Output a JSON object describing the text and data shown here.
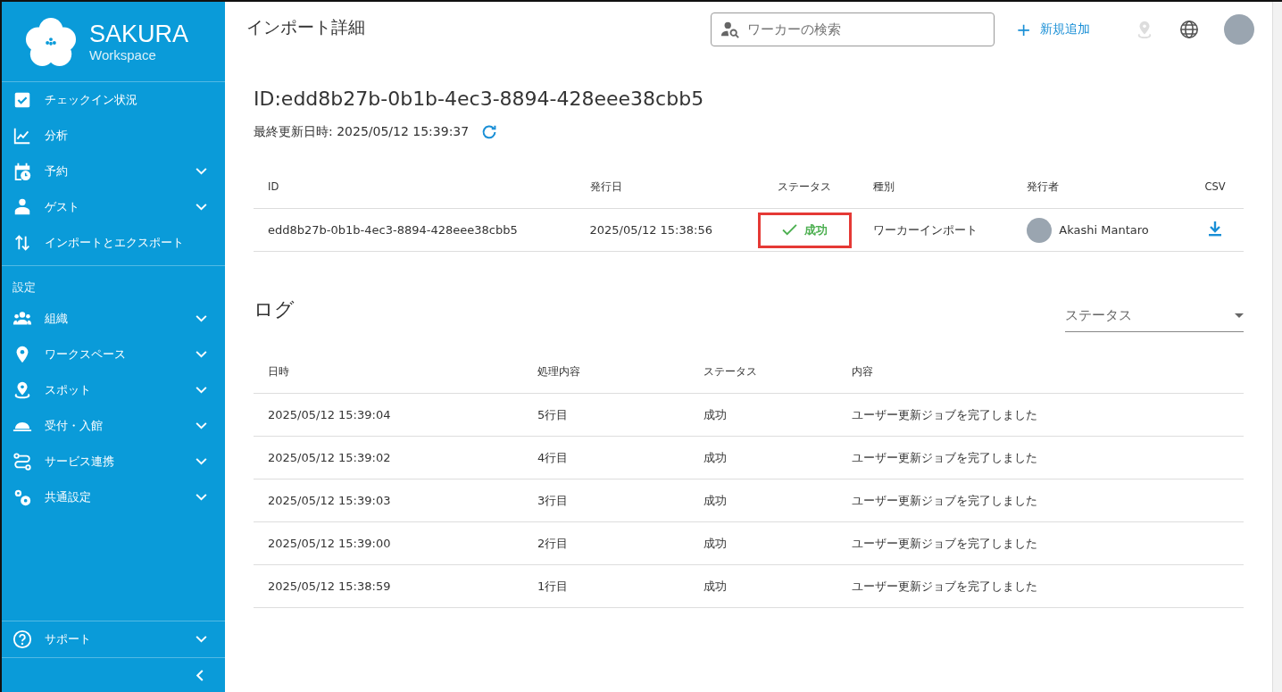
{
  "brand": {
    "name": "SAKURA",
    "sub": "Workspace"
  },
  "sidebar": {
    "items": [
      {
        "label": "チェックイン状況",
        "expandable": false
      },
      {
        "label": "分析",
        "expandable": false
      },
      {
        "label": "予約",
        "expandable": true
      },
      {
        "label": "ゲスト",
        "expandable": true
      },
      {
        "label": "インポートとエクスポート",
        "expandable": false
      }
    ],
    "section": "設定",
    "settings": [
      {
        "label": "組織",
        "expandable": true
      },
      {
        "label": "ワークスペース",
        "expandable": true
      },
      {
        "label": "スポット",
        "expandable": true
      },
      {
        "label": "受付・入館",
        "expandable": true
      },
      {
        "label": "サービス連携",
        "expandable": true
      },
      {
        "label": "共通設定",
        "expandable": true
      }
    ],
    "footer": [
      {
        "label": "サポート",
        "expandable": true
      }
    ]
  },
  "header": {
    "title": "インポート詳細",
    "search": {
      "placeholder": "ワーカーの検索"
    },
    "add_button": "新規追加",
    "add_icon": "+"
  },
  "detail": {
    "heading": "ID:edd8b27b-0b1b-4ec3-8894-428eee38cbb5",
    "updated": "最終更新日時: 2025/05/12 15:39:37",
    "columns": [
      "ID",
      "発行日",
      "ステータス",
      "種別",
      "発行者",
      "CSV"
    ],
    "row": {
      "id": "edd8b27b-0b1b-4ec3-8894-428eee38cbb5",
      "date": "2025/05/12 15:38:56",
      "status": "成功",
      "status_highlighted": true,
      "type": "ワーカーインポート",
      "issuer": "Akashi Mantaro"
    }
  },
  "log": {
    "heading": "ログ",
    "filter": {
      "placeholder": "ステータス"
    },
    "columns": [
      "日時",
      "処理内容",
      "ステータス",
      "内容"
    ],
    "rows": [
      {
        "time": "2025/05/12 15:39:04",
        "item": "5行目",
        "status": "成功",
        "message": "ユーザー更新ジョブを完了しました"
      },
      {
        "time": "2025/05/12 15:39:02",
        "item": "4行目",
        "status": "成功",
        "message": "ユーザー更新ジョブを完了しました"
      },
      {
        "time": "2025/05/12 15:39:03",
        "item": "3行目",
        "status": "成功",
        "message": "ユーザー更新ジョブを完了しました"
      },
      {
        "time": "2025/05/12 15:39:00",
        "item": "2行目",
        "status": "成功",
        "message": "ユーザー更新ジョブを完了しました"
      },
      {
        "time": "2025/05/12 15:38:59",
        "item": "1行目",
        "status": "成功",
        "message": "ユーザー更新ジョブを完了しました"
      }
    ]
  }
}
